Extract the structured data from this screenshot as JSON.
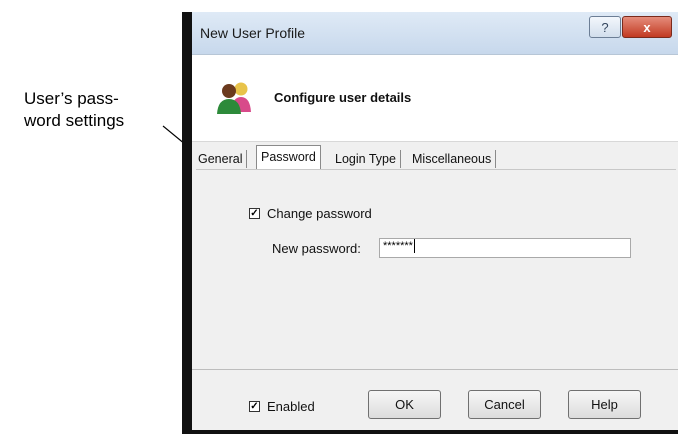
{
  "callout": {
    "line1": "User’s pass-",
    "line2": "word settings"
  },
  "window": {
    "title": "New User Profile",
    "help_button": "?",
    "close_button": "x"
  },
  "header": {
    "title": "Configure user details",
    "icon": "users-icon"
  },
  "tabs": [
    {
      "label": "General",
      "active": false
    },
    {
      "label": "Password",
      "active": true
    },
    {
      "label": "Login Type",
      "active": false
    },
    {
      "label": "Miscellaneous",
      "active": false
    }
  ],
  "password_tab": {
    "change_password_label": "Change password",
    "change_password_checked": true,
    "new_password_label": "New password:",
    "new_password_value": "*******"
  },
  "footer": {
    "enabled_label": "Enabled",
    "enabled_checked": true,
    "ok_label": "OK",
    "cancel_label": "Cancel",
    "help_label": "Help"
  }
}
